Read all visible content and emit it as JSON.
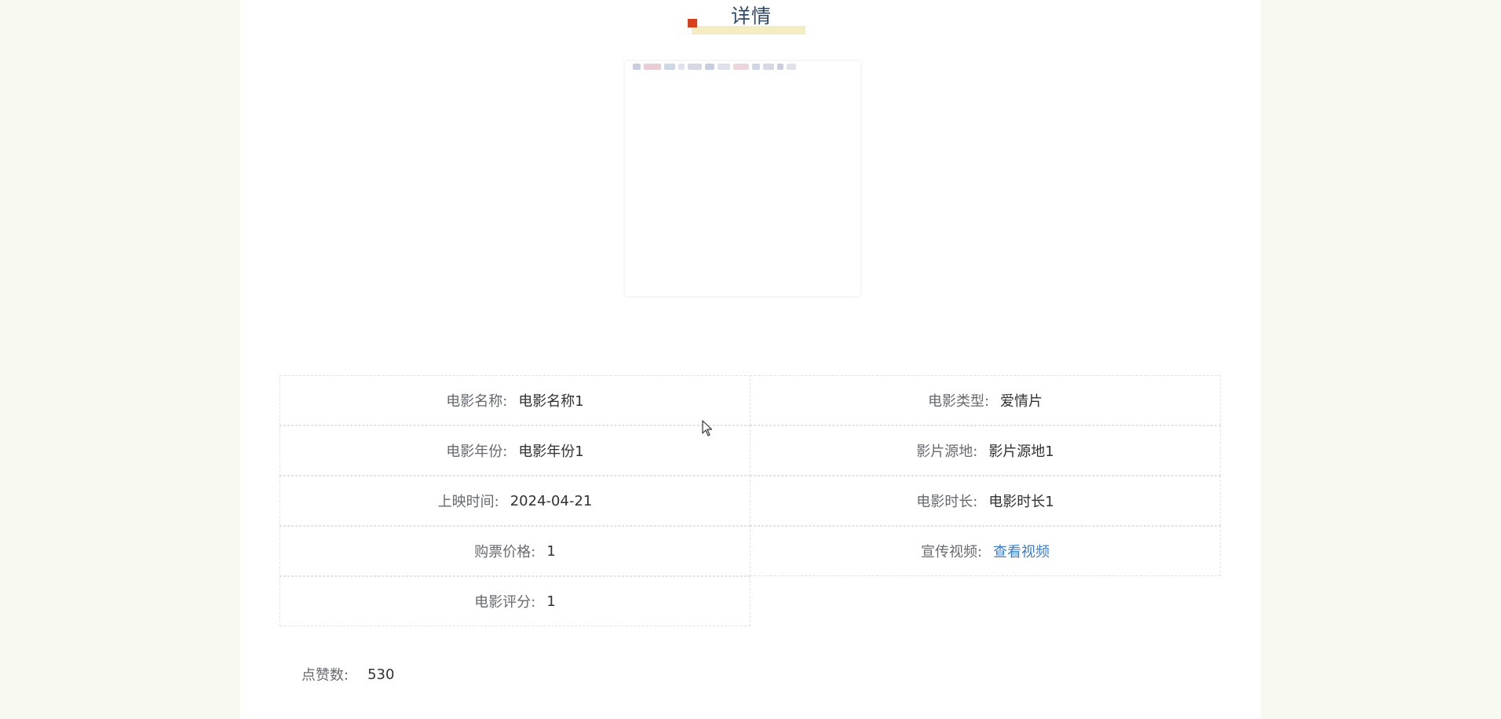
{
  "page": {
    "title": "详情"
  },
  "poster": {
    "icon": "movie-poster-image"
  },
  "details": {
    "rows": [
      [
        {
          "label": "电影名称:",
          "value": "电影名称1"
        },
        {
          "label": "电影类型:",
          "value": "爱情片"
        }
      ],
      [
        {
          "label": "电影年份:",
          "value": "电影年份1"
        },
        {
          "label": "影片源地:",
          "value": "影片源地1"
        }
      ],
      [
        {
          "label": "上映时间:",
          "value": "2024-04-21"
        },
        {
          "label": "电影时长:",
          "value": "电影时长1"
        }
      ],
      [
        {
          "label": "购票价格:",
          "value": "1"
        },
        {
          "label": "宣传视频:",
          "value": "查看视频"
        }
      ],
      [
        {
          "label": "电影评分:",
          "value": "1"
        }
      ]
    ]
  },
  "likes": {
    "label": "点赞数:",
    "value": "530"
  },
  "colors": {
    "page_background": "#f8f9f1",
    "title_text": "#2f4a66",
    "title_accent": "#d6401a",
    "title_highlight": "#f4ecc2",
    "link": "#3a7ecf"
  }
}
